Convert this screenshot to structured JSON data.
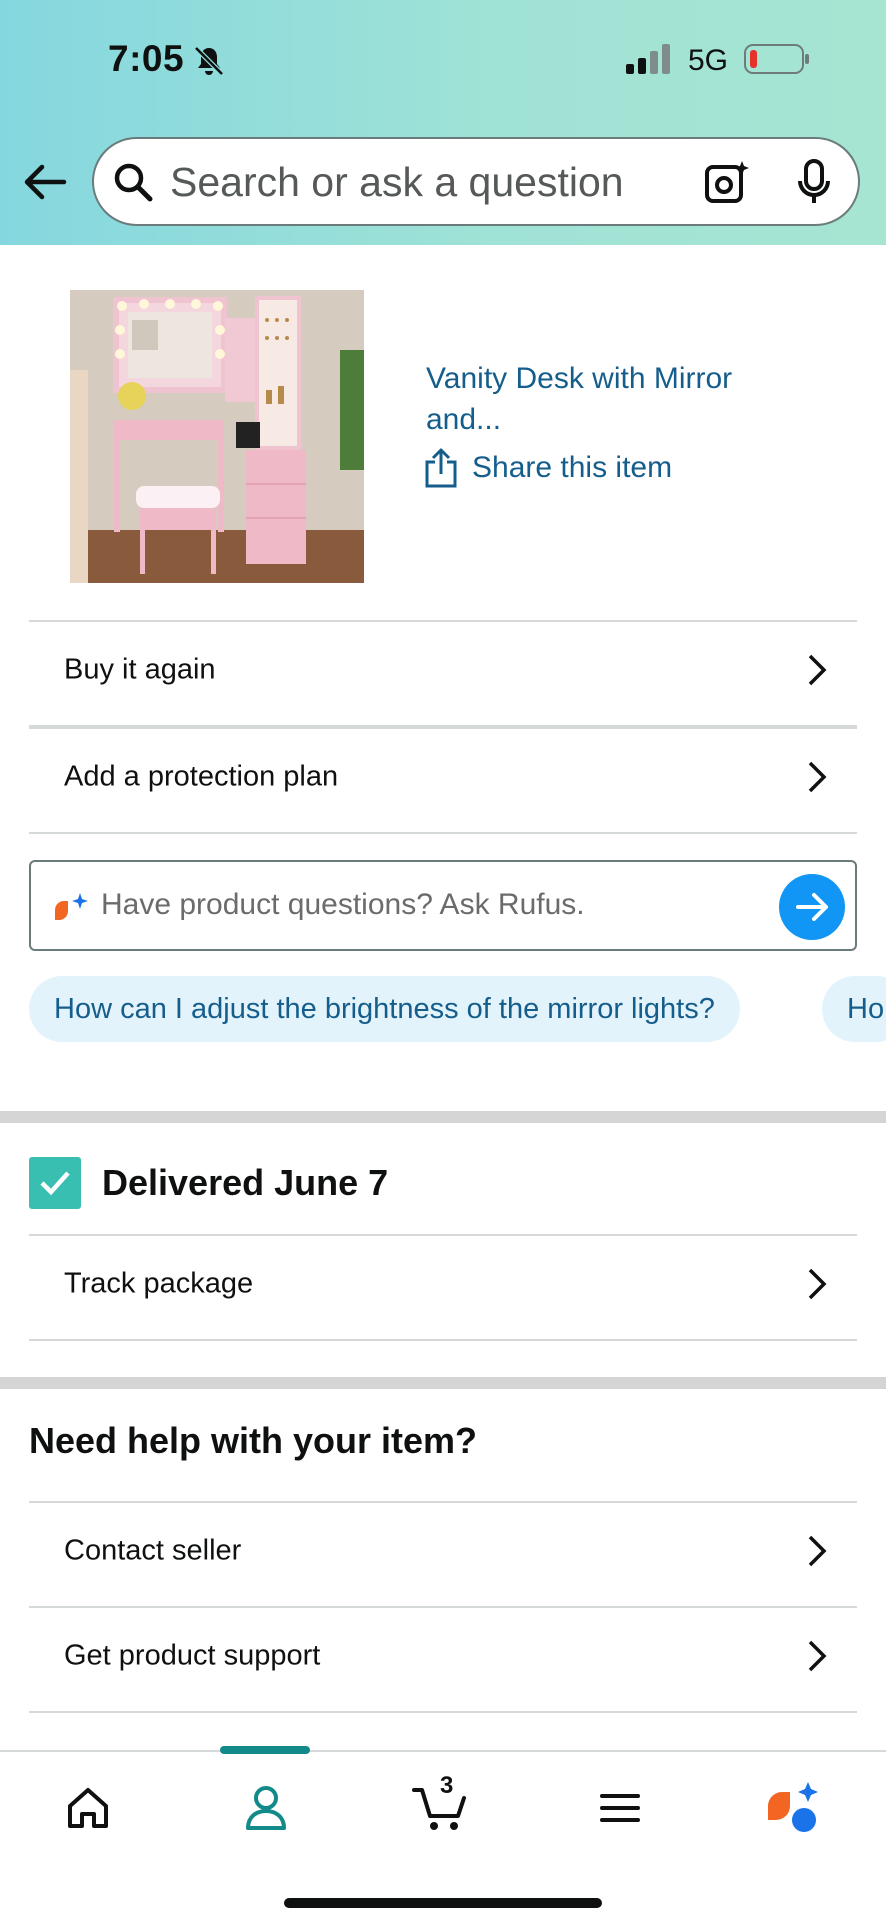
{
  "status_bar": {
    "time": "7:05",
    "network": "5G"
  },
  "search": {
    "placeholder": "Search or ask a question"
  },
  "product": {
    "title": "Vanity Desk with Mirror and...",
    "share_label": "Share this item"
  },
  "actions": {
    "buy_again": "Buy it again",
    "protection_plan": "Add a protection plan"
  },
  "rufus": {
    "placeholder": "Have product questions? Ask Rufus.",
    "chips": [
      "How can I adjust the brightness of the mirror lights?",
      "Ho"
    ]
  },
  "delivery": {
    "status": "Delivered June 7",
    "track_label": "Track package"
  },
  "help": {
    "heading": "Need help with your item?",
    "items": [
      "Contact seller",
      "Get product support"
    ]
  },
  "bottom_nav": {
    "items": [
      "home-icon",
      "account-icon",
      "cart-icon",
      "menu-icon",
      "rufus-icon"
    ],
    "cart_count": "3",
    "active": "account"
  },
  "colors": {
    "link": "#155e8c",
    "accent_teal": "#138a8a",
    "check_green": "#38bfb1",
    "rufus_blue": "#1196f5",
    "chip_bg": "#e3f3fc"
  }
}
